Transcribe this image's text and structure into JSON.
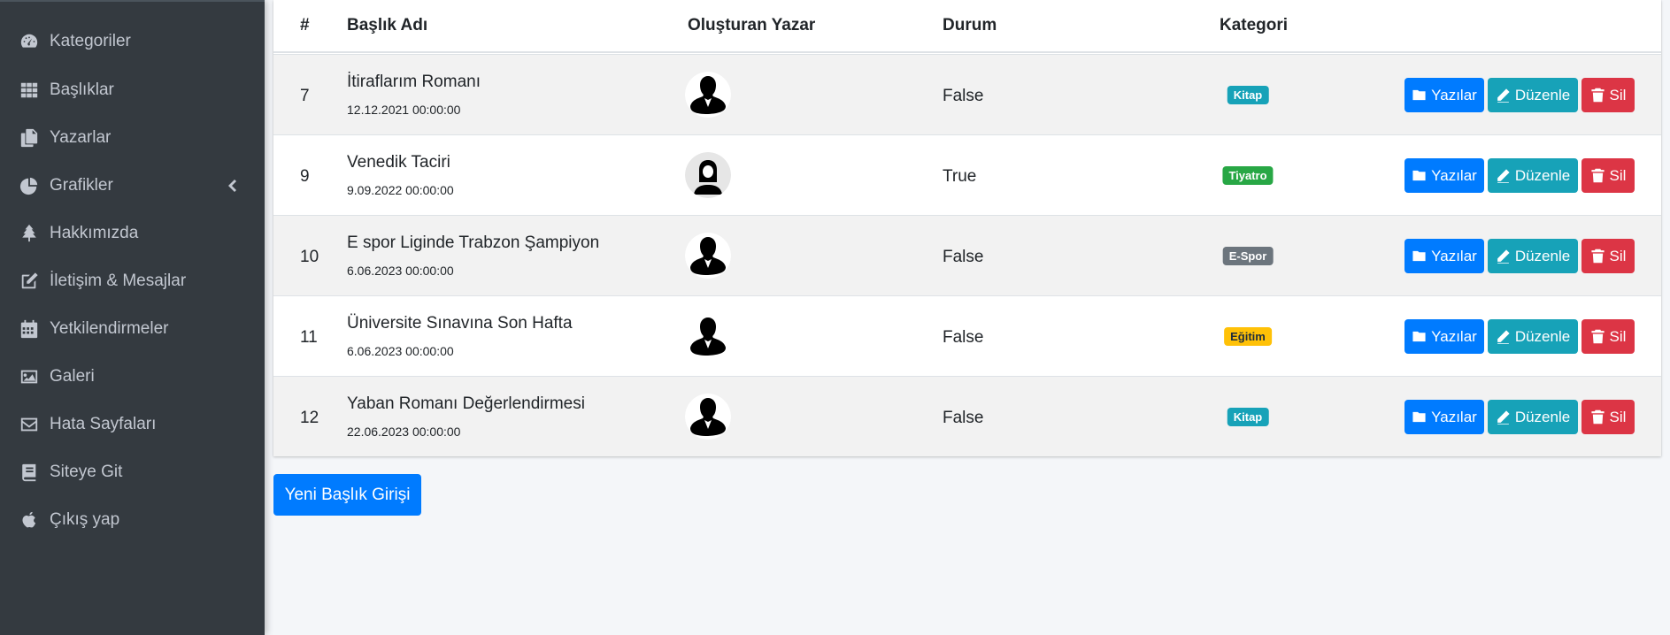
{
  "sidebar": {
    "items": [
      {
        "label": "Kategoriler",
        "icon": "dashboard-gauge-icon"
      },
      {
        "label": "Başlıklar",
        "icon": "grid-icon"
      },
      {
        "label": "Yazarlar",
        "icon": "copy-files-icon"
      },
      {
        "label": "Grafikler",
        "icon": "pie-chart-icon",
        "chevron": "chevron-left-icon"
      },
      {
        "label": "Hakkımızda",
        "icon": "tree-icon"
      },
      {
        "label": "İletişim & Mesajlar",
        "icon": "edit-icon"
      },
      {
        "label": "Yetkilendirmeler",
        "icon": "calendar-icon"
      },
      {
        "label": "Galeri",
        "icon": "image-icon"
      },
      {
        "label": "Hata Sayfaları",
        "icon": "envelope-icon"
      },
      {
        "label": "Siteye Git",
        "icon": "book-icon"
      },
      {
        "label": "Çıkış yap",
        "icon": "apple-icon"
      }
    ]
  },
  "table": {
    "headers": {
      "id": "#",
      "title": "Başlık Adı",
      "author": "Oluşturan Yazar",
      "status": "Durum",
      "category": "Kategori"
    },
    "rows": [
      {
        "id": "7",
        "title": "İtiraflarım Romanı",
        "date": "12.12.2021 00:00:00",
        "avatar": "male-avatar-icon",
        "status": "False",
        "category": "Kitap",
        "category_color": "#17a2b8",
        "category_text_color": "#ffffff"
      },
      {
        "id": "9",
        "title": "Venedik Taciri",
        "date": "9.09.2022 00:00:00",
        "avatar": "female-avatar-icon",
        "status": "True",
        "category": "Tiyatro",
        "category_color": "#28a745",
        "category_text_color": "#ffffff"
      },
      {
        "id": "10",
        "title": "E spor Liginde Trabzon Şampiyon",
        "date": "6.06.2023 00:00:00",
        "avatar": "male-avatar-icon",
        "status": "False",
        "category": "E-Spor",
        "category_color": "#6c757d",
        "category_text_color": "#ffffff"
      },
      {
        "id": "11",
        "title": "Üniversite Sınavına Son Hafta",
        "date": "6.06.2023 00:00:00",
        "avatar": "male-avatar-icon",
        "status": "False",
        "category": "Eğitim",
        "category_color": "#ffc107",
        "category_text_color": "#1f2d3d"
      },
      {
        "id": "12",
        "title": "Yaban Romanı Değerlendirmesi",
        "date": "22.06.2023 00:00:00",
        "avatar": "male-avatar-icon",
        "status": "False",
        "category": "Kitap",
        "category_color": "#17a2b8",
        "category_text_color": "#ffffff"
      }
    ],
    "actions": {
      "yazilar": "Yazılar",
      "duzenle": "Düzenle",
      "sil": "Sil"
    }
  },
  "new_button": {
    "label": "Yeni Başlık Girişi"
  },
  "colors": {
    "sidebar_bg": "#343a40",
    "primary": "#007bff",
    "info": "#17a2b8",
    "danger": "#dc3545",
    "page_bg": "#f4f6f9"
  }
}
